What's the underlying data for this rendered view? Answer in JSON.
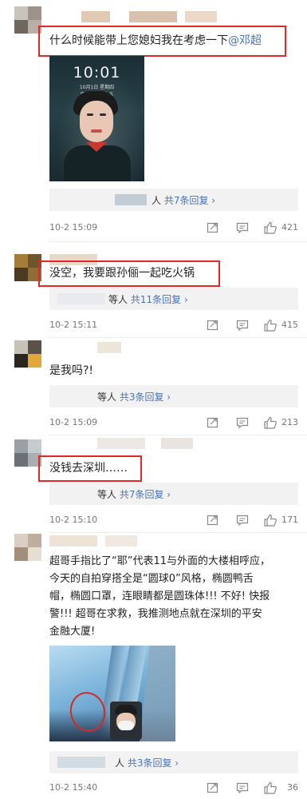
{
  "comments": [
    {
      "text": "什么时候能带上您媳妇我在考虑一下",
      "mention": "@邓超",
      "replies": "共7条回复",
      "reply_prefix": "人",
      "date": "10-2 15:09",
      "likes": "421"
    },
    {
      "text": "没空，我要跟孙俪一起吃火锅",
      "replies": "共11条回复",
      "reply_prefix": "等人",
      "date": "10-2 15:11",
      "likes": "415"
    },
    {
      "text": "是我吗?!",
      "replies": "共3条回复",
      "reply_prefix": "等人",
      "date": "10-2 15:09",
      "likes": "213"
    },
    {
      "text": "没钱去深圳……",
      "replies": "共7条回复",
      "reply_prefix": "等人",
      "date": "10-2 15:10",
      "likes": "171"
    },
    {
      "lines": [
        "超哥手指比了“耶”代表11与外面的大楼相呼应，",
        "今天的自拍穿搭全是“圆球0”风格，椭圆鸭舌",
        "帽，椭圆口罩，连眼睛都是圆珠体!!! 不好! 快报",
        "警!!! 超哥在求救，我推测地点就在深圳的平安",
        "金融大厦!"
      ],
      "replies": "共3条回复",
      "reply_prefix": "人",
      "date": "10-2 15:40",
      "likes": "36"
    }
  ],
  "phone_lockscreen": {
    "time": "10:01",
    "date_line": "10月1日 星期四",
    "sub_line": "庚子年八月十五"
  },
  "colors": {
    "highlight": "#e02828",
    "link": "#4a73b8",
    "meta_text": "#777777",
    "reply_bg": "#f2f2f2"
  },
  "icons": [
    "share-icon",
    "comment-icon",
    "like-icon"
  ]
}
